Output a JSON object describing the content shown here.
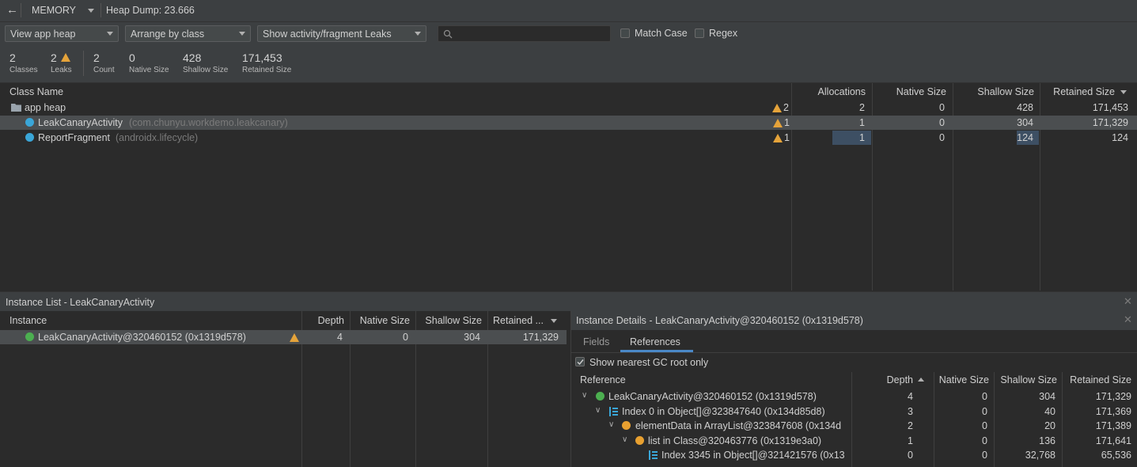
{
  "topbar": {
    "back": "←",
    "profiler": "MEMORY",
    "dump_label": "Heap Dump: 23.666"
  },
  "toolbar": {
    "heap_select": "View app heap",
    "arrange_select": "Arrange by class",
    "filter_select": "Show activity/fragment Leaks",
    "search_placeholder": "",
    "match_case": "Match Case",
    "regex": "Regex"
  },
  "stats": [
    {
      "value": "2",
      "label": "Classes"
    },
    {
      "value": "2",
      "label": "Leaks"
    },
    {
      "value": "2",
      "label": "Count"
    },
    {
      "value": "0",
      "label": "Native Size"
    },
    {
      "value": "428",
      "label": "Shallow Size"
    },
    {
      "value": "171,453",
      "label": "Retained Size"
    }
  ],
  "class_table": {
    "headers": {
      "name": "Class Name",
      "alloc": "Allocations",
      "native": "Native Size",
      "shallow": "Shallow Size",
      "retained": "Retained Size"
    },
    "rows": [
      {
        "name": "app heap",
        "pkg": "",
        "leaks": "2",
        "alloc": "2",
        "native": "0",
        "shallow": "428",
        "retained": "171,453"
      },
      {
        "name": "LeakCanaryActivity",
        "pkg": "(com.chunyu.workdemo.leakcanary)",
        "leaks": "1",
        "alloc": "1",
        "native": "0",
        "shallow": "304",
        "retained": "171,329"
      },
      {
        "name": "ReportFragment",
        "pkg": "(androidx.lifecycle)",
        "leaks": "1",
        "alloc": "1",
        "native": "0",
        "shallow": "124",
        "retained": "124"
      }
    ]
  },
  "instance_list": {
    "title": "Instance List - LeakCanaryActivity",
    "headers": {
      "instance": "Instance",
      "depth": "Depth",
      "native": "Native Size",
      "shallow": "Shallow Size",
      "retained": "Retained ..."
    },
    "rows": [
      {
        "name": "LeakCanaryActivity@320460152 (0x1319d578)",
        "depth": "4",
        "native": "0",
        "shallow": "304",
        "retained": "171,329"
      }
    ]
  },
  "instance_details": {
    "title": "Instance Details - LeakCanaryActivity@320460152 (0x1319d578)",
    "tabs": [
      "Fields",
      "References"
    ],
    "gc_root_label": "Show nearest GC root only",
    "headers": {
      "reference": "Reference",
      "depth": "Depth",
      "native": "Native Size",
      "shallow": "Shallow Size",
      "retained": "Retained Size"
    },
    "rows": [
      {
        "name": "LeakCanaryActivity@320460152 (0x1319d578)",
        "depth": "4",
        "native": "0",
        "shallow": "304",
        "retained": "171,329"
      },
      {
        "name": "Index 0 in Object[]@323847640 (0x134d85d8)",
        "depth": "3",
        "native": "0",
        "shallow": "40",
        "retained": "171,369"
      },
      {
        "name": "elementData in ArrayList@323847608 (0x134d",
        "depth": "2",
        "native": "0",
        "shallow": "20",
        "retained": "171,389"
      },
      {
        "name": "list in Class@320463776 (0x1319e3a0)",
        "depth": "1",
        "native": "0",
        "shallow": "136",
        "retained": "171,641"
      },
      {
        "name": "Index 3345 in Object[]@321421576 (0x13",
        "depth": "0",
        "native": "0",
        "shallow": "32,768",
        "retained": "65,536"
      }
    ]
  },
  "colors": {
    "warning": "#e5a33a",
    "class_icon": "#3aa6d8",
    "instance_icon": "#4caf50",
    "field_icon": "#e8a030"
  }
}
